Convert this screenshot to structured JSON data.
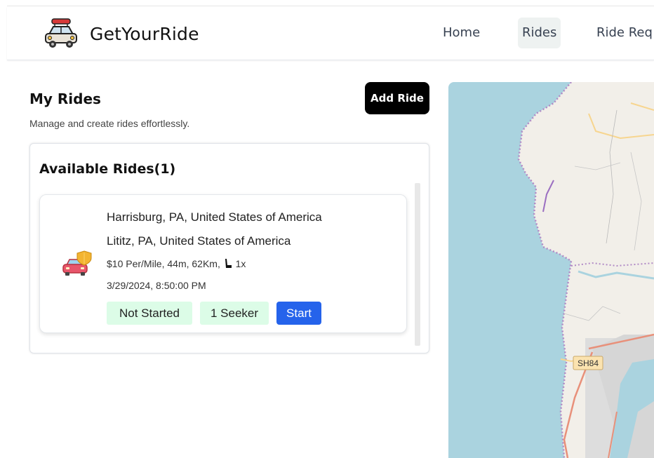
{
  "header": {
    "brand": "GetYourRide",
    "nav": [
      {
        "label": "Home"
      },
      {
        "label": "Rides"
      },
      {
        "label": "Ride Req"
      }
    ]
  },
  "page": {
    "title": "My Rides",
    "subtitle": "Manage and create rides effortlessly.",
    "add_button": "Add Ride"
  },
  "panel": {
    "title": "Available Rides(1)"
  },
  "ride": {
    "from": "Harrisburg, PA, United States of America",
    "to": "Lititz, PA, United States of America",
    "details_prefix": "$10 Per/Mile, 44m, 62Km,",
    "seats": "1x",
    "datetime": "3/29/2024, 8:50:00 PM",
    "status": "Not Started",
    "seekers": "1 Seeker",
    "start_button": "Start"
  },
  "map": {
    "road_label": "SH84"
  },
  "colors": {
    "accent_blue": "#2563eb",
    "badge_green": "#dcfce7",
    "water": "#aad3df",
    "land": "#f2efe9"
  }
}
